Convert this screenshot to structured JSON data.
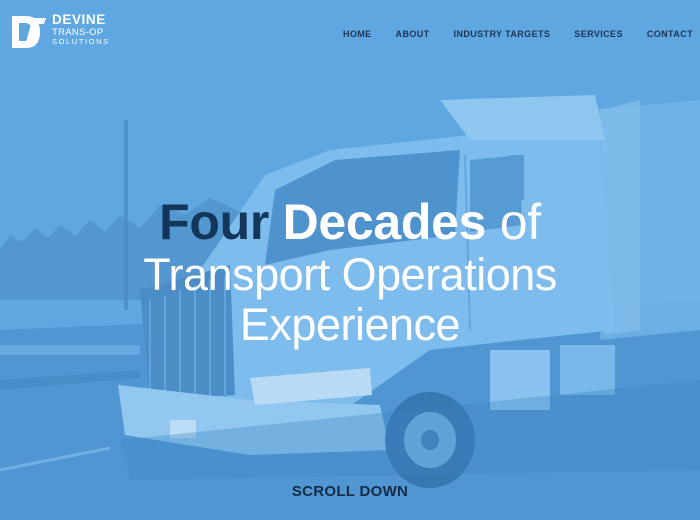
{
  "brand": {
    "line1": "DEVINE",
    "line2": "TRANS-OP",
    "line3": "SOLUTIONS"
  },
  "nav": {
    "items": [
      {
        "label": "HOME"
      },
      {
        "label": "ABOUT"
      },
      {
        "label": "INDUSTRY TARGETS"
      },
      {
        "label": "SERVICES"
      },
      {
        "label": "CONTACT"
      }
    ]
  },
  "hero": {
    "word1": "Four",
    "word2": "Decades",
    "word3": "of",
    "line2": "Transport Operations",
    "line3": "Experience",
    "scroll_label": "SCROLL DOWN"
  },
  "colors": {
    "overlay": "#5fa6dd",
    "dark_navy": "#13365a",
    "nav_text": "#1f3552",
    "white": "#ffffff"
  }
}
